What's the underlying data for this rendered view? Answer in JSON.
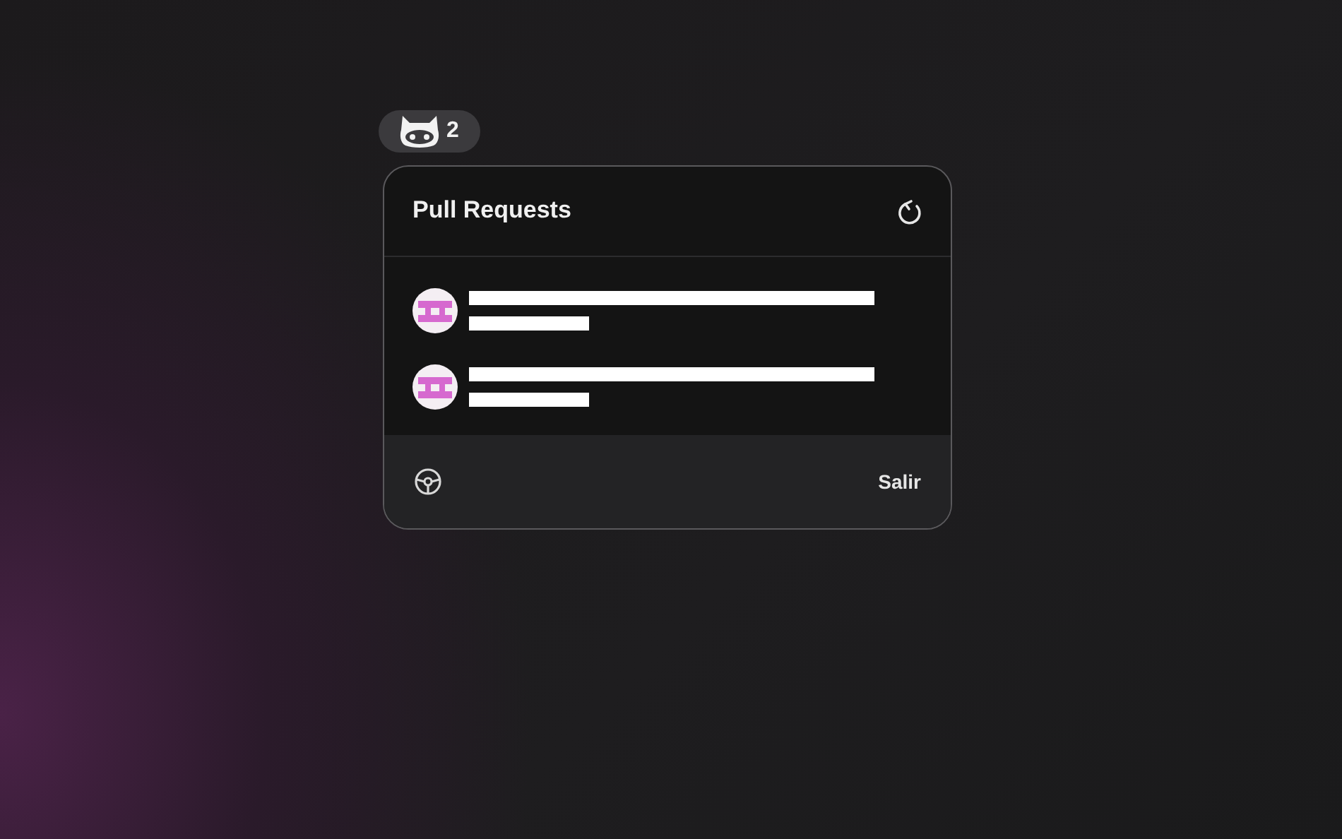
{
  "menu_bar_item": {
    "count": "2"
  },
  "panel": {
    "title": "Pull Requests",
    "pull_requests": [
      {
        "kind": "redacted"
      },
      {
        "kind": "redacted"
      }
    ],
    "footer": {
      "quit_label": "Salir"
    }
  }
}
